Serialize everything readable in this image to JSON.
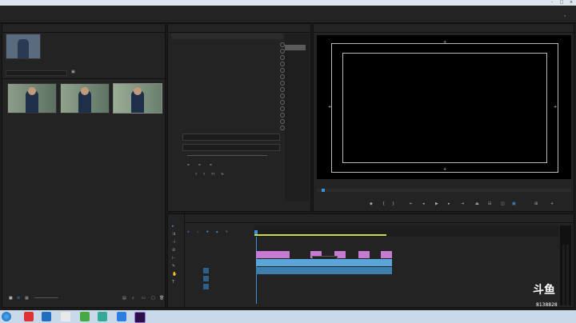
{
  "titlebar": {
    "title": ""
  },
  "menubar": {
    "items": [
      "",
      "",
      "",
      "",
      "",
      "",
      "",
      "",
      ""
    ]
  },
  "workspace": {
    "tabs": [
      "",
      "",
      "",
      "",
      "",
      "",
      "",
      "",
      ""
    ],
    "active_index": 7
  },
  "project_panel": {
    "tabs": [
      "",
      "",
      ""
    ],
    "thumbs": [
      {
        "label": "",
        "duration": ""
      },
      {
        "label": "",
        "duration": ""
      },
      {
        "label": "",
        "duration": ""
      }
    ]
  },
  "effect_controls": {
    "tabs": [
      "",
      ""
    ],
    "rows": [
      {
        "label": "",
        "value": "",
        "value2": ""
      },
      {
        "label": "",
        "value": "",
        "value2": ""
      },
      {
        "label": "",
        "value": "",
        "value2": ""
      },
      {
        "label": "",
        "value": "",
        "value2": ""
      },
      {
        "label": "",
        "value": "",
        "value2": ""
      },
      {
        "label": "",
        "value": "",
        "value2": ""
      },
      {
        "label": "",
        "value": "",
        "value2": ""
      },
      {
        "label": "",
        "value": "",
        "value2": ""
      },
      {
        "label": "",
        "value": "",
        "value2": ""
      },
      {
        "label": "",
        "value": "",
        "value2": ""
      },
      {
        "label": "",
        "value": "",
        "value2": ""
      },
      {
        "label": "",
        "value": "",
        "value2": ""
      },
      {
        "label": "",
        "value": "",
        "value2": ""
      },
      {
        "label": "",
        "value": "",
        "value2": ""
      }
    ],
    "text_content": "",
    "font": ""
  },
  "program_monitor": {
    "tab": "",
    "caption": "",
    "timecode_left": "",
    "timecode_right": "",
    "fit": ""
  },
  "timeline": {
    "tab": "",
    "timecode": "",
    "tracks": [
      "",
      "",
      "",
      "",
      "",
      "",
      ""
    ]
  },
  "watermark": {
    "brand": "斗鱼",
    "room": "8138828"
  },
  "taskbar": {
    "clock_time": "",
    "clock_date": ""
  },
  "colors": {
    "accent": "#3d8fe0",
    "clip_pink": "#c77ad1",
    "clip_blue": "#5aa6d8",
    "workarea": "#cfd84a"
  }
}
